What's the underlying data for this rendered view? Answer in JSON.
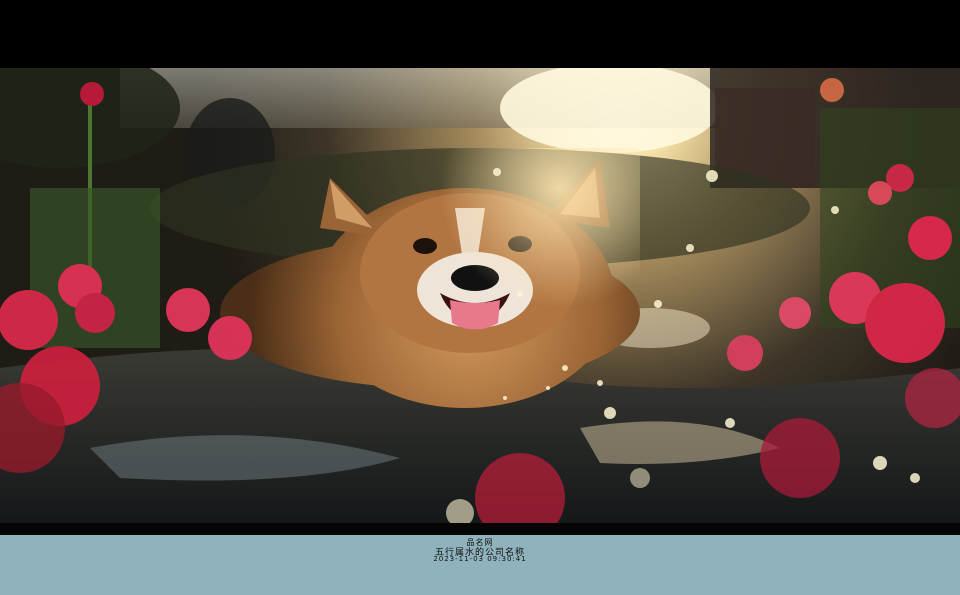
{
  "photo": {
    "subject": "dog-in-water-with-flowers",
    "colors": {
      "sky": "#e9d7a8",
      "sun": "#fff6d8",
      "fur": "#b97a43",
      "water": "#262a2c",
      "flower": "#d8294a",
      "caption_bar": "#8fb2bd"
    }
  },
  "caption": {
    "site_name": "品名网",
    "title": "五行属水的公司名称",
    "timestamp": "2023-11-03 09:30:41"
  }
}
